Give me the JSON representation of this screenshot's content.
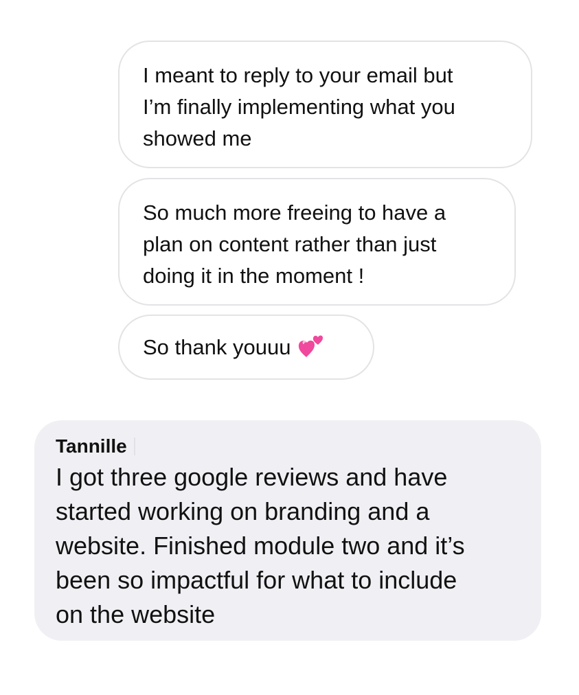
{
  "messages": [
    {
      "lines": [
        "I meant to reply to your email but",
        "I’m finally implementing what you",
        "showed me"
      ]
    },
    {
      "lines": [
        "So much more freeing to have a",
        "plan on content rather than just",
        "doing it in the moment !"
      ]
    },
    {
      "text": "So thank youuu",
      "emoji_icon": "two-hearts-icon"
    }
  ],
  "reply": {
    "sender": "Tannille",
    "lines": [
      "I got three google reviews and have",
      "started working on branding and a",
      "website. Finished module two and it’s",
      "been so impactful for what to include",
      "on the website"
    ]
  },
  "colors": {
    "bubble_border": "#e3e3e6",
    "reply_background": "#f0f0f4",
    "heart": "#f0489c"
  }
}
